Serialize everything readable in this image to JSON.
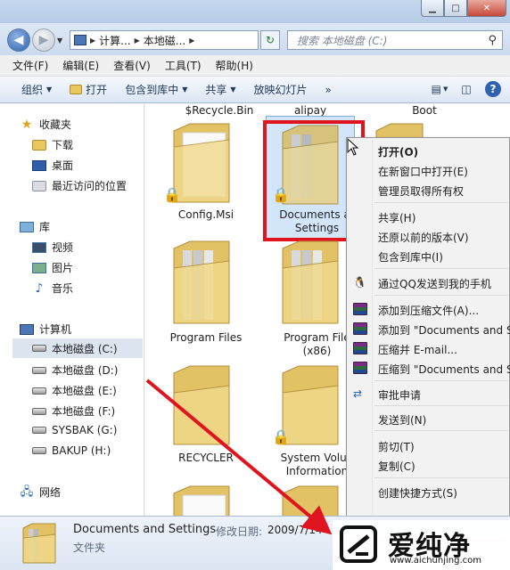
{
  "address": {
    "crumbs": [
      "计算...",
      "本地磁..."
    ],
    "search_placeholder": "搜索 本地磁盘 (C:)"
  },
  "caption": {
    "minimize": "▁",
    "maximize": "□",
    "close": "✕"
  },
  "menubar": [
    "文件(F)",
    "编辑(E)",
    "查看(V)",
    "工具(T)",
    "帮助(H)"
  ],
  "commandbar": {
    "organize": "组织",
    "open": "打开",
    "include_in_library": "包含到库中",
    "share": "共享",
    "slideshow": "放映幻灯片",
    "more": "»"
  },
  "navpane": {
    "favorites": "收藏夹",
    "favorites_items": [
      "下载",
      "桌面",
      "最近访问的位置"
    ],
    "libraries": "库",
    "library_items": [
      "视频",
      "图片",
      "音乐"
    ],
    "computer": "计算机",
    "drives": [
      "本地磁盘 (C:)",
      "本地磁盘 (D:)",
      "本地磁盘 (E:)",
      "本地磁盘 (F:)",
      "SYSBAK (G:)",
      "BAKUP (H:)"
    ],
    "network": "网络"
  },
  "files": {
    "top_row": [
      "$Recycle.Bin",
      "alipay",
      "Boot"
    ],
    "items": [
      {
        "name": "Config.Msi",
        "locked": true
      },
      {
        "name_line1": "Documents ar",
        "name_line2": "Settings",
        "locked": true,
        "selected": true
      },
      {
        "name": "Program Files",
        "locked": false
      },
      {
        "name_line1": "Program File",
        "name_line2": "(x86)",
        "locked": false
      },
      {
        "name": "RECYCLER",
        "locked": false
      },
      {
        "name_line1": "System Volun",
        "name_line2": "Information",
        "locked": true
      }
    ]
  },
  "context_menu": {
    "items": [
      "打开(O)",
      "在新窗口中打开(E)",
      "管理员取得所有权",
      "共享(H)",
      "还原以前的版本(V)",
      "包含到库中(I)",
      "通过QQ发送到我的手机",
      "添加到压缩文件(A)...",
      "添加到 \"Documents and S",
      "压缩并 E-mail...",
      "压缩到 \"Documents and S",
      "审批申请",
      "发送到(N)",
      "剪切(T)",
      "复制(C)",
      "创建快捷方式(S)"
    ]
  },
  "details": {
    "name": "Documents and Settings",
    "date_label": "修改日期:",
    "date": "2009/7/14",
    "type": "文件夹"
  },
  "watermark": {
    "text": "爱纯净",
    "url": "www.aichunjing.com"
  },
  "colors": {
    "highlight_red": "#e0141e",
    "folder_yellow": "#e9c85f",
    "selection_blue": "#b4d4f5"
  }
}
